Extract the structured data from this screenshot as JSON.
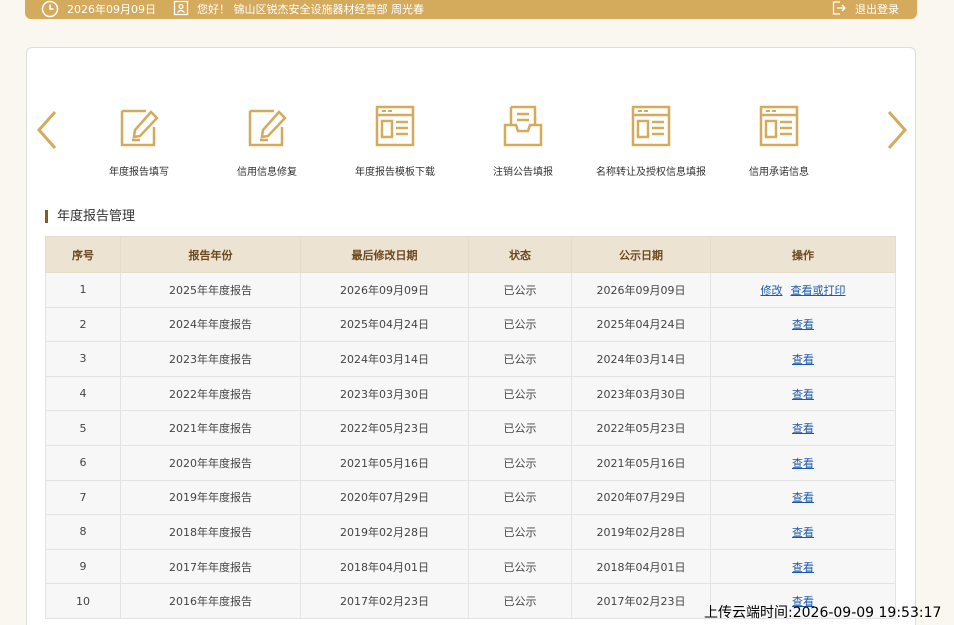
{
  "header": {
    "date": "2026年09月09日",
    "greeting": "您好！ 锦山区锐杰安全设施器材经营部   周光春",
    "logout_label": "退出登录"
  },
  "quick_links": [
    {
      "label": "年度报告填写",
      "icon": "edit-icon"
    },
    {
      "label": "信用信息修复",
      "icon": "edit-icon"
    },
    {
      "label": "年度报告模板下载",
      "icon": "template-icon"
    },
    {
      "label": "注销公告填报",
      "icon": "inbox-icon"
    },
    {
      "label": "名称转让及授权信息填报",
      "icon": "template-icon"
    },
    {
      "label": "信用承诺信息",
      "icon": "template-icon"
    }
  ],
  "section_title": "年度报告管理",
  "table": {
    "headers": [
      "序号",
      "报告年份",
      "最后修改日期",
      "状态",
      "公示日期",
      "操作"
    ],
    "rows": [
      {
        "no": "1",
        "year": "2025年年度报告",
        "modified": "2026年09月09日",
        "status": "已公示",
        "published": "2026年09月09日",
        "edit": "修改",
        "view": "查看或打印"
      },
      {
        "no": "2",
        "year": "2024年年度报告",
        "modified": "2025年04月24日",
        "status": "已公示",
        "published": "2025年04月24日",
        "view": "查看"
      },
      {
        "no": "3",
        "year": "2023年年度报告",
        "modified": "2024年03月14日",
        "status": "已公示",
        "published": "2024年03月14日",
        "view": "查看"
      },
      {
        "no": "4",
        "year": "2022年年度报告",
        "modified": "2023年03月30日",
        "status": "已公示",
        "published": "2023年03月30日",
        "view": "查看"
      },
      {
        "no": "5",
        "year": "2021年年度报告",
        "modified": "2022年05月23日",
        "status": "已公示",
        "published": "2022年05月23日",
        "view": "查看"
      },
      {
        "no": "6",
        "year": "2020年年度报告",
        "modified": "2021年05月16日",
        "status": "已公示",
        "published": "2021年05月16日",
        "view": "查看"
      },
      {
        "no": "7",
        "year": "2019年年度报告",
        "modified": "2020年07月29日",
        "status": "已公示",
        "published": "2020年07月29日",
        "view": "查看"
      },
      {
        "no": "8",
        "year": "2018年年度报告",
        "modified": "2019年02月28日",
        "status": "已公示",
        "published": "2019年02月28日",
        "view": "查看"
      },
      {
        "no": "9",
        "year": "2017年年度报告",
        "modified": "2018年04月01日",
        "status": "已公示",
        "published": "2018年04月01日",
        "view": "查看"
      },
      {
        "no": "10",
        "year": "2016年年度报告",
        "modified": "2017年02月23日",
        "status": "已公示",
        "published": "2017年02月23日",
        "view": "查看"
      }
    ]
  },
  "upload_time": "上传云端时间:2026-09-09 19:53:17",
  "colors": {
    "accent": "#d4aa5c",
    "header_bg": "#ede3d3",
    "link": "#1f5aa8"
  }
}
